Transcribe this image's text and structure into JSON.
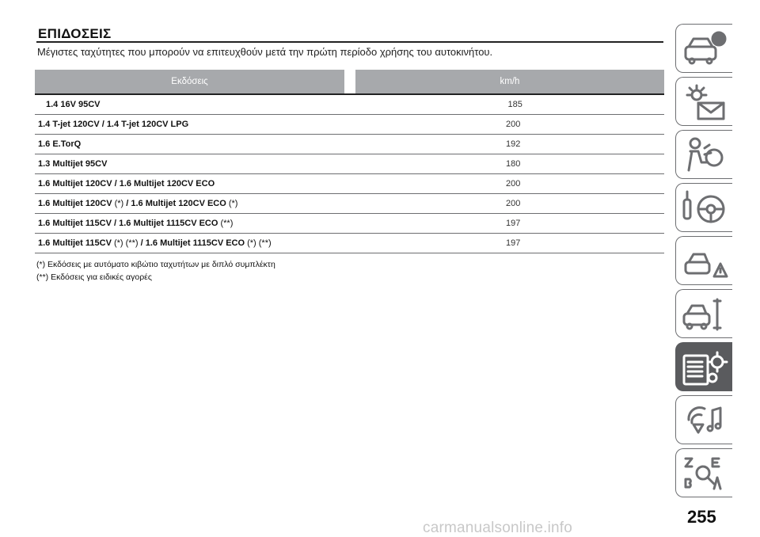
{
  "page": {
    "title": "ΕΠΙΔΟΣΕΙΣ",
    "subtitle": "Μέγιστες ταχύτητες που μπορούν να επιτευχθούν μετά την πρώτη περίοδο χρήσης του αυτοκινήτου.",
    "page_number": "255",
    "watermark": "carmanualsonline.info"
  },
  "table": {
    "headers": [
      "Εκδόσεις",
      "km/h"
    ],
    "rows": [
      {
        "version": [
          {
            "t": "1.4 16V 95CV",
            "b": true
          }
        ],
        "speed": "185",
        "indent": true
      },
      {
        "version": [
          {
            "t": "1.4 T-jet 120CV / 1.4 T-jet 120CV LPG",
            "b": true
          }
        ],
        "speed": "200"
      },
      {
        "version": [
          {
            "t": "1.6 E.TorQ",
            "b": true
          }
        ],
        "speed": "192"
      },
      {
        "version": [
          {
            "t": "1.3 Multijet 95CV",
            "b": true
          }
        ],
        "speed": "180"
      },
      {
        "version": [
          {
            "t": "1.6 Multijet 120CV / 1.6 Multijet 120CV ECO",
            "b": true
          }
        ],
        "speed": "200"
      },
      {
        "version": [
          {
            "t": "1.6 Multijet 120CV ",
            "b": true
          },
          {
            "t": "(*)",
            "b": false
          },
          {
            "t": " / 1.6 Multijet 120CV ECO ",
            "b": true
          },
          {
            "t": "(*)",
            "b": false
          }
        ],
        "speed": "200"
      },
      {
        "version": [
          {
            "t": "1.6 Multijet 115CV / 1.6 Multijet 1115CV ECO ",
            "b": true
          },
          {
            "t": "(**)",
            "b": false
          }
        ],
        "speed": "197"
      },
      {
        "version": [
          {
            "t": "1.6 Multijet 115CV ",
            "b": true
          },
          {
            "t": "(*) (**)",
            "b": false
          },
          {
            "t": " / 1.6 Multijet 1115CV ECO ",
            "b": true
          },
          {
            "t": "(*) (**)",
            "b": false
          }
        ],
        "speed": "197"
      }
    ]
  },
  "notes": [
    "(*) Εκδόσεις με αυτόματο κιβώτιο ταχυτήτων με διπλό συμπλέκτη",
    "(**) Εκδόσεις για ειδικές αγορές"
  ],
  "side_tabs": [
    {
      "icon": "car-info-icon",
      "active": false
    },
    {
      "icon": "dashboard-lights-icon",
      "active": false
    },
    {
      "icon": "safety-airbag-icon",
      "active": false
    },
    {
      "icon": "key-steering-wheel-icon",
      "active": false
    },
    {
      "icon": "car-emergency-icon",
      "active": false
    },
    {
      "icon": "car-maintenance-icon",
      "active": false
    },
    {
      "icon": "technical-data-icon",
      "active": true
    },
    {
      "icon": "multimedia-icon",
      "active": false
    },
    {
      "icon": "alphabetical-index-icon",
      "active": false
    }
  ],
  "colors": {
    "header_bg": "#a7a9ac",
    "active_tab": "#5a5b5e",
    "rule": "#222222"
  }
}
